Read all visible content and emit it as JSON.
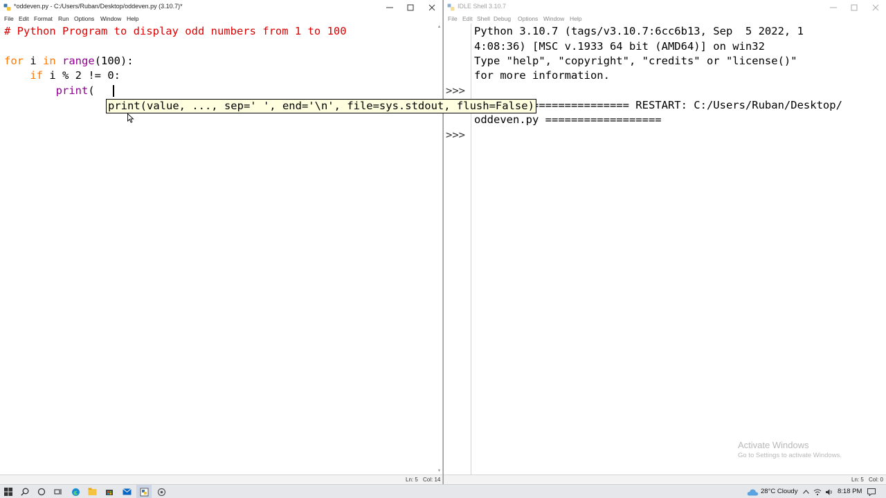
{
  "editor": {
    "title": "*oddeven.py - C:/Users/Ruban/Desktop/oddeven.py (3.10.7)*",
    "menu": [
      "File",
      "Edit",
      "Format",
      "Run",
      "Options",
      "Window",
      "Help"
    ],
    "code": {
      "comment": "# Python Program to display odd numbers from 1 to 100",
      "line3": {
        "kw": "for",
        "mid1": " i ",
        "kw2": "in",
        "sp": " ",
        "builtin": "range",
        "rest": "(100):"
      },
      "line4": {
        "indent": "    ",
        "kw": "if",
        "rest": " i % 2 != 0:"
      },
      "line5": {
        "indent": "        ",
        "builtin": "print",
        "rest": "("
      }
    },
    "calltip": "print(value, ..., sep=' ', end='\\n', file=sys.stdout, flush=False)",
    "status": {
      "ln": "Ln: 5",
      "col": "Col: 14"
    }
  },
  "shell": {
    "title": "IDLE Shell 3.10.7",
    "menu": [
      "File",
      "Edit",
      "Shell",
      "Debug",
      "Options",
      "Window",
      "Help"
    ],
    "prompt": ">>>",
    "lines": [
      "Python 3.10.7 (tags/v3.10.7:6cc6b13, Sep  5 2022, 1",
      "4:08:36) [MSC v.1933 64 bit (AMD64)] on win32",
      "Type \"help\", \"copyright\", \"credits\" or \"license()\"",
      "for more information.",
      "",
      "======================== RESTART: C:/Users/Ruban/Desktop/",
      "oddeven.py =================="
    ],
    "status": {
      "ln": "Ln: 5",
      "col": "Col: 0"
    }
  },
  "watermark": {
    "title": "Activate Windows",
    "subtitle": "Go to Settings to activate Windows."
  },
  "taskbar": {
    "weather": "28°C  Cloudy",
    "time": "8:18 PM"
  },
  "colors": {
    "comment": "#dd0000",
    "keyword": "#ff7700",
    "builtin": "#900090",
    "calltip_bg": "#ffffe0"
  }
}
